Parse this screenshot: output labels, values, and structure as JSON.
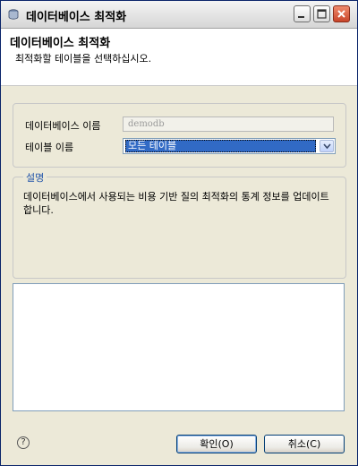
{
  "window": {
    "title": "데이터베이스 최적화"
  },
  "header": {
    "title": "데이터베이스 최적화",
    "subtitle": "최적화할 테이블을 선택하십시오."
  },
  "form": {
    "db_label": "데이터베이스 이름",
    "db_value": "demodb",
    "table_label": "테이블 이름",
    "table_value": "모든 테이블"
  },
  "description": {
    "title": "설명",
    "text": "데이터베이스에서 사용되는 비용 기반 질의 최적화의 통계 정보를 업데이트합니다."
  },
  "buttons": {
    "ok": "확인(O)",
    "cancel": "취소(C)",
    "help": "?"
  }
}
